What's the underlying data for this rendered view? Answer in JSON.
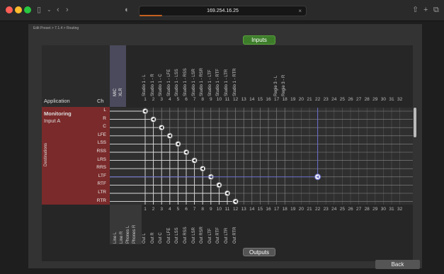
{
  "browser": {
    "url": "169.254.16.25"
  },
  "breadcrumb": "Edit Preset > 7.1.4 > Routing",
  "buttons": {
    "inputs": "Inputs",
    "outputs": "Outputs",
    "back": "Back"
  },
  "left": {
    "app_header": "Application",
    "ch_header": "Ch",
    "app_name": "Monitoring",
    "input": "Input A",
    "side_label": "Destinations"
  },
  "row_labels": [
    "L",
    "R",
    "C",
    "LFE",
    "LSS",
    "RSS",
    "LRS",
    "RRS",
    "LTF",
    "RTF",
    "LTR",
    "RTR"
  ],
  "mic_xlr": [
    "MIC",
    "XLR"
  ],
  "inputs": [
    "Studio 1 - L",
    "Studio 1 - R",
    "Studio 1 - C",
    "Studio 1 - LFE",
    "Studio 1 - LSS",
    "Studio 1 - RSS",
    "Studio 1 - LSR",
    "Studio 1 - RSR",
    "Studio 1 - LTF",
    "Studio 1 - RTF",
    "Studio 1 - LTR",
    "Studio 1 - RTR",
    "",
    "",
    "",
    "",
    "Regie 3 - L",
    "Regie 3 - R",
    "",
    "",
    "",
    "",
    "",
    "",
    "",
    "",
    "",
    "",
    "",
    "",
    "",
    ""
  ],
  "numbers": [
    "1",
    "2",
    "3",
    "4",
    "5",
    "6",
    "7",
    "8",
    "9",
    "10",
    "11",
    "12",
    "13",
    "14",
    "15",
    "16",
    "17",
    "18",
    "19",
    "20",
    "21",
    "22",
    "23",
    "24",
    "25",
    "26",
    "27",
    "28",
    "29",
    "30",
    "31",
    "32"
  ],
  "out_prefix": [
    "Line L",
    "Line R",
    "Phones L",
    "Phones R"
  ],
  "outputs": [
    "Out L",
    "Out R",
    "Out C",
    "Out LFE",
    "Out LSS",
    "Out RSS",
    "Out LSR",
    "Out RSR",
    "Out LTF",
    "Out RTF",
    "Out LTR",
    "Out RTR",
    "",
    "",
    "",
    "",
    "",
    "",
    "",
    "",
    "",
    "",
    "",
    "",
    "",
    "",
    "",
    "",
    "",
    "",
    "",
    ""
  ],
  "routes": [
    [
      0,
      0
    ],
    [
      1,
      1
    ],
    [
      2,
      2
    ],
    [
      3,
      3
    ],
    [
      4,
      4
    ],
    [
      5,
      5
    ],
    [
      6,
      6
    ],
    [
      7,
      7
    ],
    [
      8,
      8
    ],
    [
      9,
      9
    ],
    [
      10,
      10
    ],
    [
      11,
      11
    ],
    [
      8,
      21
    ]
  ],
  "colors": {
    "red": "#7a2a2a",
    "green": "#3d7d2a",
    "route": "#6a6fd0"
  }
}
